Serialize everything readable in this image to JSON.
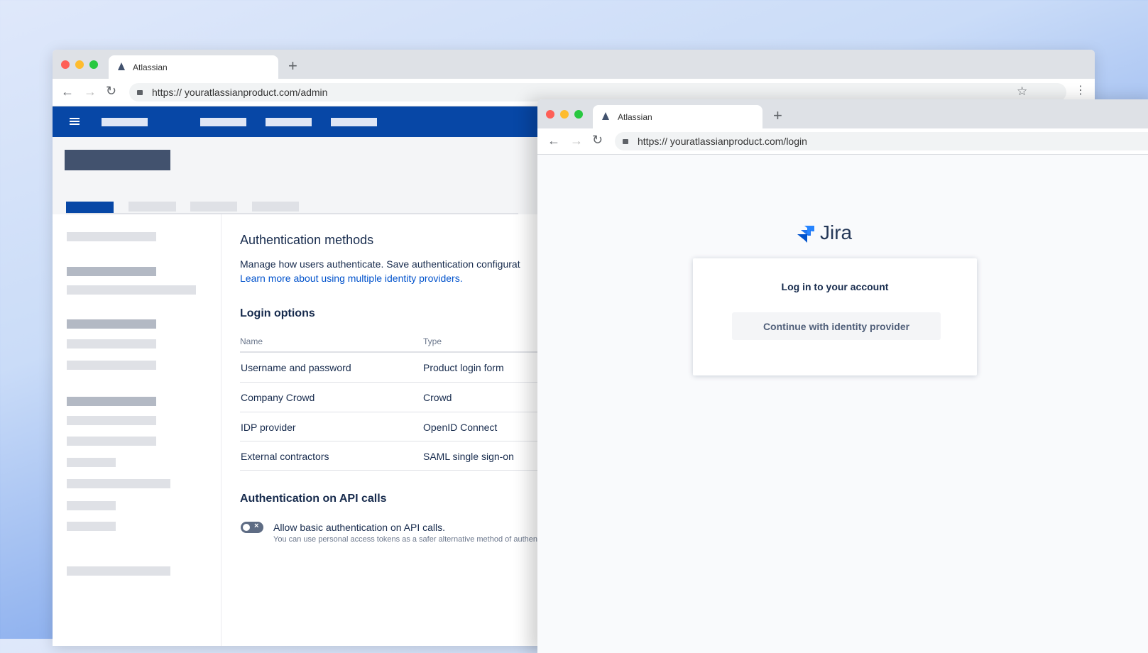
{
  "admin_window": {
    "tab_title": "Atlassian",
    "new_tab": "+",
    "url": "https:// youratlassianproduct.com/admin",
    "content": {
      "title": "Authentication methods",
      "description": "Manage how users authenticate. Save authentication configurat",
      "learn_more_link": "Learn more about using multiple identity providers.",
      "login_options_heading": "Login options",
      "table": {
        "headers": [
          "Name",
          "Type"
        ],
        "rows": [
          [
            "Username and password",
            "Product login form"
          ],
          [
            "Company Crowd",
            "Crowd"
          ],
          [
            "IDP provider",
            "OpenID Connect"
          ],
          [
            "External contractors",
            "SAML single sign-on"
          ]
        ]
      },
      "api_heading": "Authentication on API calls",
      "api_toggle_label": "Allow basic authentication on API calls.",
      "api_toggle_state": "off",
      "api_help": "You can use personal access tokens as a safer alternative method of authenti"
    }
  },
  "login_window": {
    "tab_title": "Atlassian",
    "new_tab": "+",
    "url": "https:// youratlassianproduct.com/login",
    "logo_text": "Jira",
    "card_title": "Log in to your account",
    "continue_button": "Continue with identity provider"
  },
  "colors": {
    "nav": "#0747a6",
    "link": "#0052cc",
    "text": "#172b4d"
  }
}
